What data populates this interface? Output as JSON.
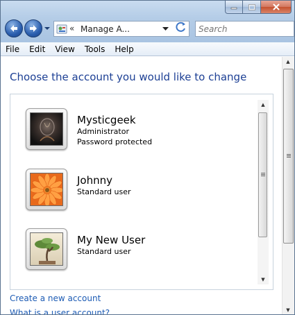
{
  "window": {
    "caption": {
      "minimize_icon": "minimize-icon",
      "maximize_icon": "maximize-icon",
      "close_icon": "close-icon"
    }
  },
  "nav": {
    "back_icon": "back-arrow-icon",
    "forward_icon": "forward-arrow-icon",
    "address": {
      "chevron": "«",
      "text": "Manage A..."
    },
    "search_placeholder": "Search"
  },
  "menu": [
    "File",
    "Edit",
    "View",
    "Tools",
    "Help"
  ],
  "content": {
    "heading": "Choose the account you would like to change",
    "accounts": [
      {
        "name": "Mysticgeek",
        "lines": [
          "Administrator",
          "Password protected"
        ],
        "picture": "dark-abstract-picture"
      },
      {
        "name": "Johnny",
        "lines": [
          "Standard user"
        ],
        "picture": "orange-flower-picture"
      },
      {
        "name": "My New User",
        "lines": [
          "Standard user"
        ],
        "picture": "bonsai-tree-picture"
      }
    ],
    "links": [
      "Create a new account",
      "What is a user account?"
    ]
  },
  "colors": {
    "heading": "#1c3f94",
    "link": "#1c5bb4"
  }
}
